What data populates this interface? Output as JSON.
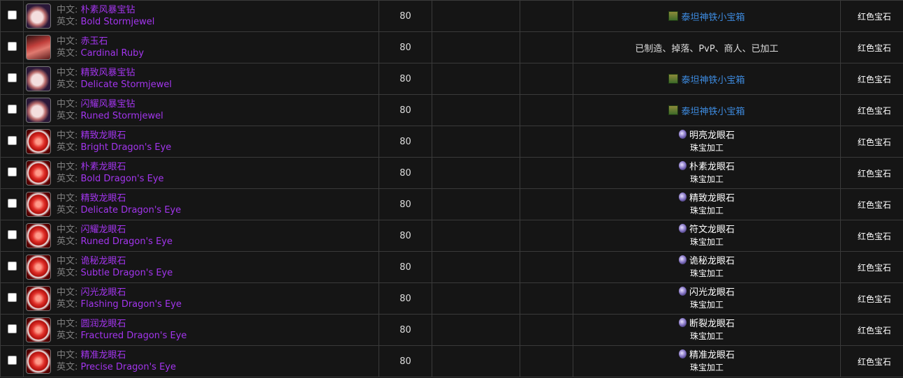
{
  "labels": {
    "cn": "中文: ",
    "en": "英文: "
  },
  "colors": {
    "item_name": "#a335ee",
    "source_link": "#3d8be0",
    "background": "#151515",
    "border": "#3a3a3a"
  },
  "rows": [
    {
      "icon": "stormjewel",
      "cn": "朴素风暴宝钻",
      "en": "Bold Stormjewel",
      "level": "80",
      "source": {
        "kind": "chest",
        "text": "泰坦神铁小宝箱"
      },
      "type": "红色宝石"
    },
    {
      "icon": "ruby",
      "cn": "赤玉石",
      "en": "Cardinal Ruby",
      "level": "80",
      "source": {
        "kind": "plain",
        "text": "已制造、掉落、PvP、商人、已加工"
      },
      "type": "红色宝石"
    },
    {
      "icon": "stormjewel",
      "cn": "精致风暴宝钻",
      "en": "Delicate Stormjewel",
      "level": "80",
      "source": {
        "kind": "chest",
        "text": "泰坦神铁小宝箱"
      },
      "type": "红色宝石"
    },
    {
      "icon": "stormjewel",
      "cn": "闪耀风暴宝钻",
      "en": "Runed Stormjewel",
      "level": "80",
      "source": {
        "kind": "chest",
        "text": "泰坦神铁小宝箱"
      },
      "type": "红色宝石"
    },
    {
      "icon": "dragoneye",
      "cn": "精致龙眼石",
      "en": "Bright Dragon's Eye",
      "level": "80",
      "source": {
        "kind": "recipe",
        "text": "明亮龙眼石",
        "sub": "珠宝加工"
      },
      "type": "红色宝石"
    },
    {
      "icon": "dragoneye",
      "cn": "朴素龙眼石",
      "en": "Bold Dragon's Eye",
      "level": "80",
      "source": {
        "kind": "recipe",
        "text": "朴素龙眼石",
        "sub": "珠宝加工"
      },
      "type": "红色宝石"
    },
    {
      "icon": "dragoneye",
      "cn": "精致龙眼石",
      "en": "Delicate Dragon's Eye",
      "level": "80",
      "source": {
        "kind": "recipe",
        "text": "精致龙眼石",
        "sub": "珠宝加工"
      },
      "type": "红色宝石"
    },
    {
      "icon": "dragoneye",
      "cn": "闪耀龙眼石",
      "en": "Runed Dragon's Eye",
      "level": "80",
      "source": {
        "kind": "recipe",
        "text": "符文龙眼石",
        "sub": "珠宝加工"
      },
      "type": "红色宝石"
    },
    {
      "icon": "dragoneye",
      "cn": "诡秘龙眼石",
      "en": "Subtle Dragon's Eye",
      "level": "80",
      "source": {
        "kind": "recipe",
        "text": "诡秘龙眼石",
        "sub": "珠宝加工"
      },
      "type": "红色宝石"
    },
    {
      "icon": "dragoneye",
      "cn": "闪光龙眼石",
      "en": "Flashing Dragon's Eye",
      "level": "80",
      "source": {
        "kind": "recipe",
        "text": "闪光龙眼石",
        "sub": "珠宝加工"
      },
      "type": "红色宝石"
    },
    {
      "icon": "dragoneye",
      "cn": "圆润龙眼石",
      "en": "Fractured Dragon's Eye",
      "level": "80",
      "source": {
        "kind": "recipe",
        "text": "断裂龙眼石",
        "sub": "珠宝加工"
      },
      "type": "红色宝石"
    },
    {
      "icon": "dragoneye",
      "cn": "精准龙眼石",
      "en": "Precise Dragon's Eye",
      "level": "80",
      "source": {
        "kind": "recipe",
        "text": "精准龙眼石",
        "sub": "珠宝加工"
      },
      "type": "红色宝石"
    }
  ]
}
